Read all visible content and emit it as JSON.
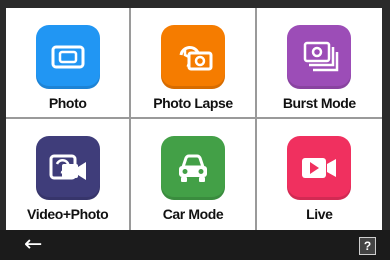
{
  "modes": [
    {
      "label": "Photo",
      "icon": "camera-icon",
      "color": "#2196F3"
    },
    {
      "label": "Photo Lapse",
      "icon": "photo-lapse-icon",
      "color": "#F57C00"
    },
    {
      "label": "Burst Mode",
      "icon": "burst-icon",
      "color": "#9C4DB7"
    },
    {
      "label": "Video+Photo",
      "icon": "video-photo-icon",
      "color": "#3F3D7A"
    },
    {
      "label": "Car Mode",
      "icon": "car-icon",
      "color": "#43A047"
    },
    {
      "label": "Live",
      "icon": "live-icon",
      "color": "#F0305F"
    }
  ],
  "bottom_bar": {
    "back_icon": "←",
    "help_icon": "?"
  }
}
